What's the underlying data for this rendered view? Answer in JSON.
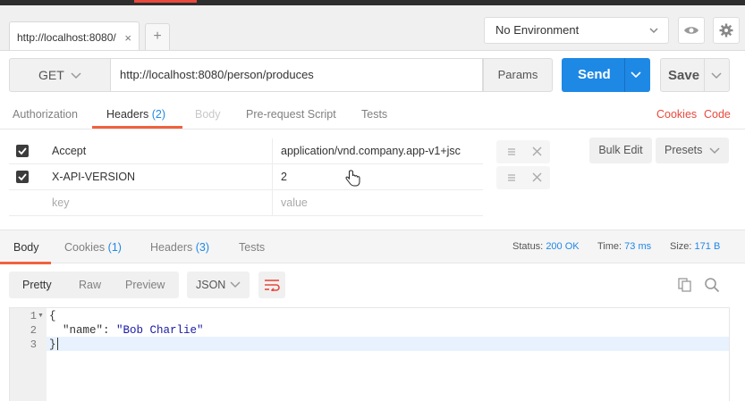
{
  "tabbar": {
    "tab_title": "http://localhost:8080/",
    "close_glyph": "×",
    "add_glyph": "+"
  },
  "environment": {
    "selected": "No Environment"
  },
  "request": {
    "method": "GET",
    "url": "http://localhost:8080/person/produces",
    "params_label": "Params",
    "send_label": "Send",
    "save_label": "Save"
  },
  "request_tabs": {
    "authorization": "Authorization",
    "headers": "Headers",
    "headers_count": "(2)",
    "body": "Body",
    "prerequest": "Pre-request Script",
    "tests": "Tests",
    "cookies": "Cookies",
    "code": "Code"
  },
  "headers": {
    "rows": [
      {
        "key": "Accept",
        "value": "application/vnd.company.app-v1+jsc",
        "checked": true
      },
      {
        "key": "X-API-VERSION",
        "value": "2",
        "checked": true
      }
    ],
    "key_placeholder": "key",
    "value_placeholder": "value",
    "bulk_edit": "Bulk Edit",
    "presets": "Presets"
  },
  "response_tabs": {
    "body": "Body",
    "cookies": "Cookies",
    "cookies_count": "(1)",
    "headers": "Headers",
    "headers_count": "(3)",
    "tests": "Tests"
  },
  "response_status": {
    "status_label": "Status:",
    "status_value": "200 OK",
    "time_label": "Time:",
    "time_value": "73 ms",
    "size_label": "Size:",
    "size_value": "171 B"
  },
  "view": {
    "pretty": "Pretty",
    "raw": "Raw",
    "preview": "Preview",
    "format": "JSON"
  },
  "editor": {
    "line_numbers": [
      "1",
      "2",
      "3"
    ],
    "line1": "{",
    "line2_key": "\"name\"",
    "line2_sep": ": ",
    "line2_value": "\"Bob Charlie\"",
    "line3": "}"
  },
  "colors": {
    "accent": "#1e88e5",
    "tab_underline": "#f0623d",
    "link_red": "#e8493c"
  }
}
